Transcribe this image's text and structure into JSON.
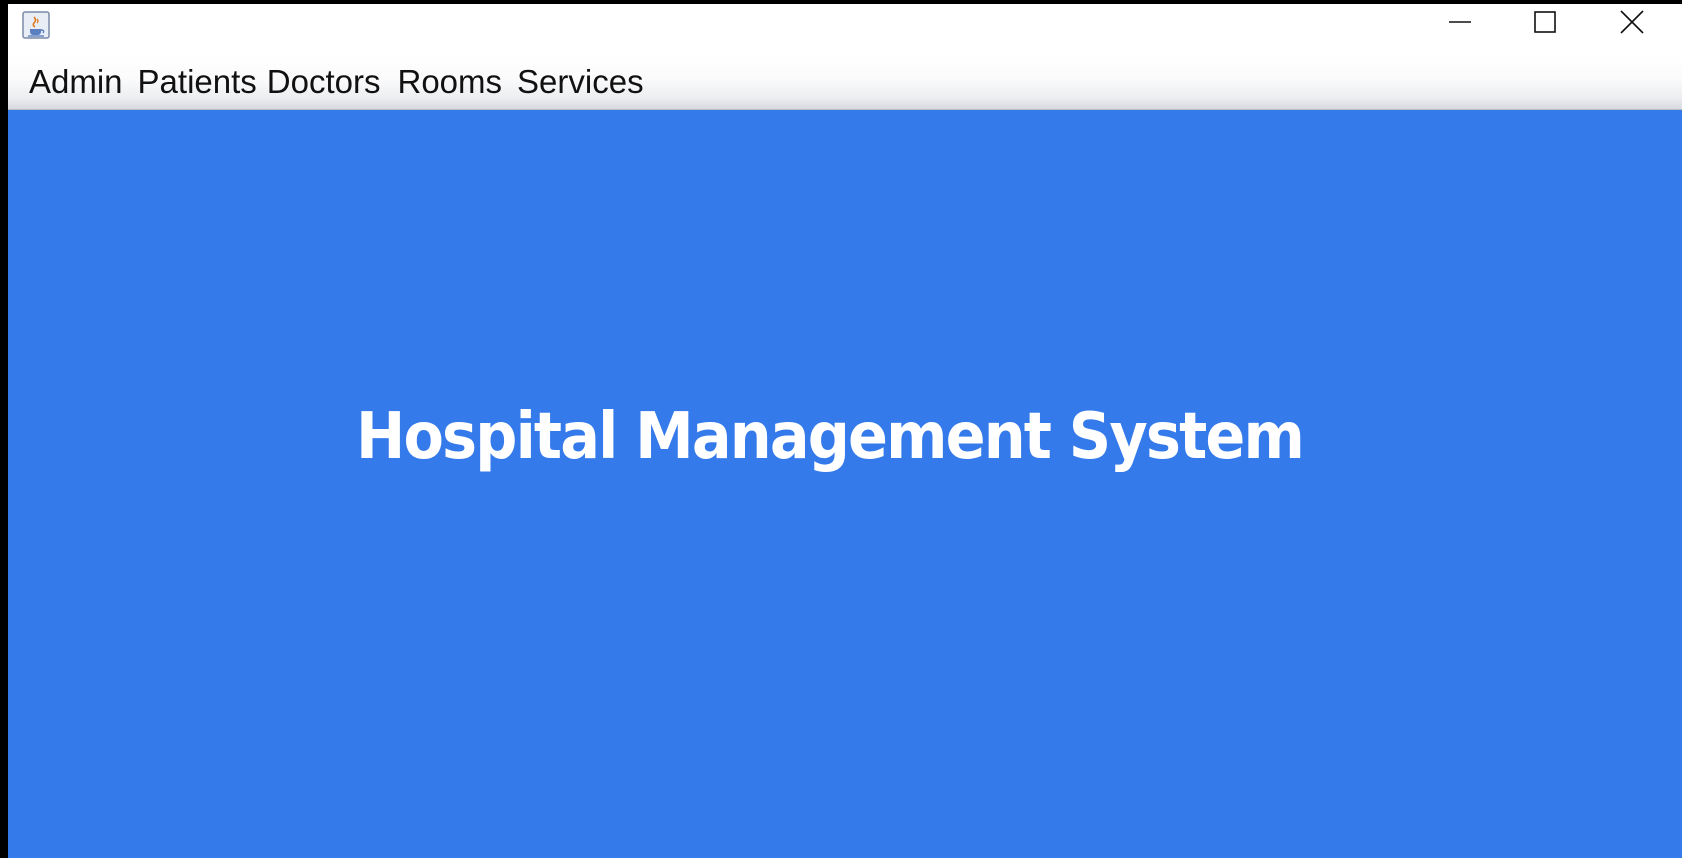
{
  "window": {
    "title": "",
    "controls": {
      "minimize_icon": "minimize-icon",
      "maximize_icon": "maximize-icon",
      "close_icon": "close-icon"
    },
    "app_icon": "java-cup-icon"
  },
  "menubar": {
    "items": [
      {
        "label": "Admin"
      },
      {
        "label": "Patients"
      },
      {
        "label": "Doctors"
      },
      {
        "label": "Rooms"
      },
      {
        "label": "Services"
      }
    ]
  },
  "main": {
    "heading": "Hospital Management System",
    "background_color": "#347aea",
    "heading_color": "#ffffff"
  }
}
